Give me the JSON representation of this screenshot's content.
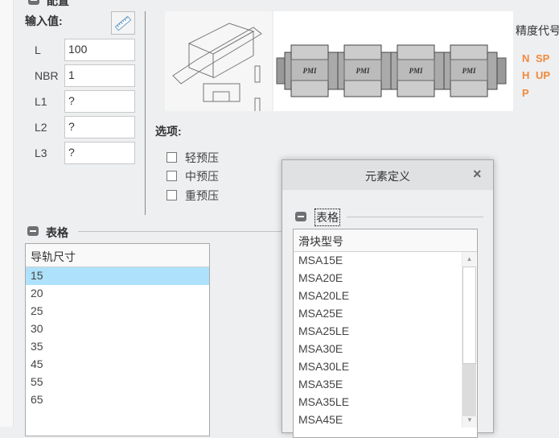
{
  "config_section": {
    "title": "配置",
    "input_label": "输入值:",
    "ruler_icon": "ruler-icon"
  },
  "inputs": [
    {
      "label": "L",
      "value": "100"
    },
    {
      "label": "NBR",
      "value": "1"
    },
    {
      "label": "L1",
      "value": "?"
    },
    {
      "label": "L2",
      "value": "?"
    },
    {
      "label": "L3",
      "value": "?"
    }
  ],
  "images": {
    "brand": "PMI"
  },
  "precision": {
    "title": "精度代号",
    "codes": [
      "N",
      "SP",
      "H",
      "UP",
      "P"
    ],
    "color": "#f08a3c"
  },
  "options": {
    "title": "选项:",
    "items": [
      "轻预压",
      "中预压",
      "重预压"
    ]
  },
  "table_section": {
    "title": "表格",
    "header": "导轨尺寸",
    "rows": [
      "15",
      "20",
      "25",
      "30",
      "35",
      "45",
      "55",
      "65"
    ],
    "selected": "15"
  },
  "dialog": {
    "title": "元素定义",
    "close": "×",
    "group_title": "表格",
    "header": "滑块型号",
    "rows": [
      "MSA15E",
      "MSA20E",
      "MSA20LE",
      "MSA25E",
      "MSA25LE",
      "MSA30E",
      "MSA30LE",
      "MSA35E",
      "MSA35LE",
      "MSA45E"
    ]
  }
}
